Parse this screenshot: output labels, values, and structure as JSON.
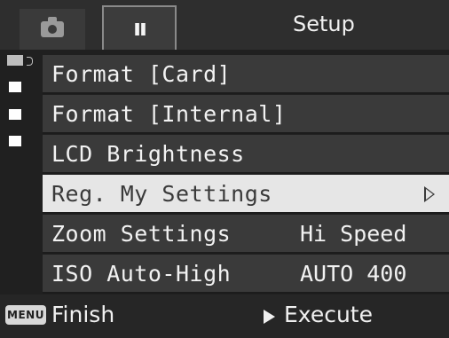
{
  "header": {
    "tabs": [
      {
        "icon": "camera-icon",
        "active": false
      },
      {
        "icon": "wrench-icon",
        "active": true
      }
    ],
    "title": "Setup"
  },
  "scroll_indicator": {
    "total_pages": 4,
    "current_page": 1
  },
  "menu": {
    "items": [
      {
        "label": "Format [Card]",
        "value": "",
        "selected": false
      },
      {
        "label": "Format [Internal]",
        "value": "",
        "selected": false
      },
      {
        "label": "LCD Brightness",
        "value": "",
        "selected": false
      },
      {
        "label": "Reg. My Settings",
        "value": "",
        "selected": true,
        "has_submenu": true
      },
      {
        "label": "Zoom Settings",
        "value": "Hi Speed",
        "selected": false
      },
      {
        "label": "ISO Auto-High",
        "value": "AUTO 400",
        "selected": false
      }
    ]
  },
  "footer": {
    "menu_key": "MENU",
    "finish": "Finish",
    "execute": "Execute"
  },
  "colors": {
    "background": "#202020",
    "row": "#3a3a3a",
    "selected_row": "#e6e6e6",
    "text": "#f2f2f2"
  }
}
